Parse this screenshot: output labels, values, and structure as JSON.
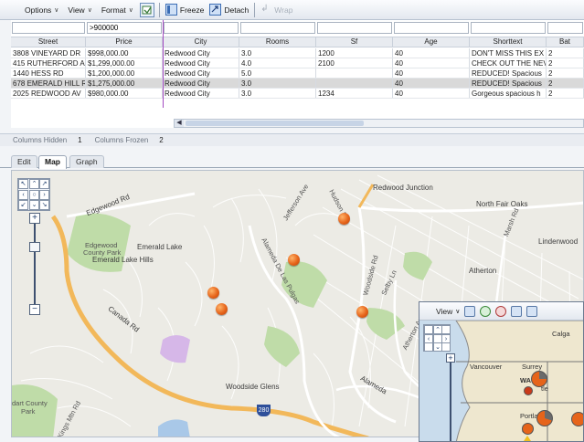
{
  "toolbar": {
    "options": "Options",
    "view": "View",
    "format": "Format",
    "freeze": "Freeze",
    "detach": "Detach",
    "wrap": "Wrap"
  },
  "grid": {
    "filters": [
      "",
      ">900000",
      "",
      "",
      "",
      "",
      "",
      ""
    ],
    "columns": [
      "Street",
      "Price",
      "City",
      "Rooms",
      "Sf",
      "Age",
      "Shorttext",
      "Bat"
    ],
    "rows": [
      [
        "3808 VINEYARD DR",
        "$998,000.00",
        "Redwood City",
        "3.0",
        "1200",
        "40",
        "DON'T MISS THIS EX",
        "2"
      ],
      [
        "415 RUTHERFORD A'",
        "$1,299,000.00",
        "Redwood City",
        "4.0",
        "2100",
        "40",
        "CHECK OUT THE NEV",
        "2"
      ],
      [
        "1440 HESS RD",
        "$1,200,000.00",
        "Redwood City",
        "5.0",
        "",
        "40",
        "REDUCED! Spacious",
        "2"
      ],
      [
        "678 EMERALD HILL R",
        "$1,275,000.00",
        "Redwood City",
        "3.0",
        "",
        "40",
        "REDUCED! Spacious",
        "2"
      ],
      [
        "2025 REDWOOD AV",
        "$980,000.00",
        "Redwood City",
        "3.0",
        "1234",
        "40",
        "Gorgeous spacious h",
        "2"
      ]
    ],
    "selected_row": 3
  },
  "status": {
    "columns_hidden_label": "Columns Hidden",
    "columns_hidden": "1",
    "columns_frozen_label": "Columns Frozen",
    "columns_frozen": "2"
  },
  "tabs": [
    "Edit",
    "Map",
    "Graph"
  ],
  "active_tab": "Map",
  "map": {
    "labels": {
      "redwood_junction": "Redwood Junction",
      "north_fair_oaks": "North Fair Oaks",
      "lindenwood": "Lindenwood",
      "atherton": "Atherton",
      "edgewood_rd": "Edgewood Rd",
      "edgewood_park_1": "Edgewood",
      "edgewood_park_2": "County Park",
      "emerald_lake": "Emerald Lake",
      "emerald_lake_hills": "Emerald Lake Hills",
      "canada_rd": "Canada Rd",
      "woodside_glens": "Woodside Glens",
      "alameda": "Alameda",
      "alameda_de_las_pulgas": "Alameda De Las Pulgas",
      "jefferson_ave": "Jefferson Ave",
      "hudson_st": "Hudson St",
      "woodside_rd": "Woodside Rd",
      "selby_ln": "Selby Ln",
      "marsh_rd": "Marsh Rd",
      "atherton_ave": "Atherton Ave",
      "highway": "280",
      "huddart_park_1": "dart County",
      "huddart_park_2": "Park",
      "kings_mtn": "Kings Mtn Rd"
    }
  },
  "inset": {
    "view": "View",
    "labels": {
      "calgary": "Calga",
      "vancouver": "Vancouver",
      "surrey": "Surrey",
      "wa": "WA",
      "seattle": "tle",
      "portland": "Portland",
      "or": "OR"
    }
  },
  "colors": {
    "frozen_divider": "#a44bc2",
    "marker": "#e6641a",
    "park": "#bfdca8",
    "water": "#a9c8e8",
    "highway": "#f2b85a"
  }
}
